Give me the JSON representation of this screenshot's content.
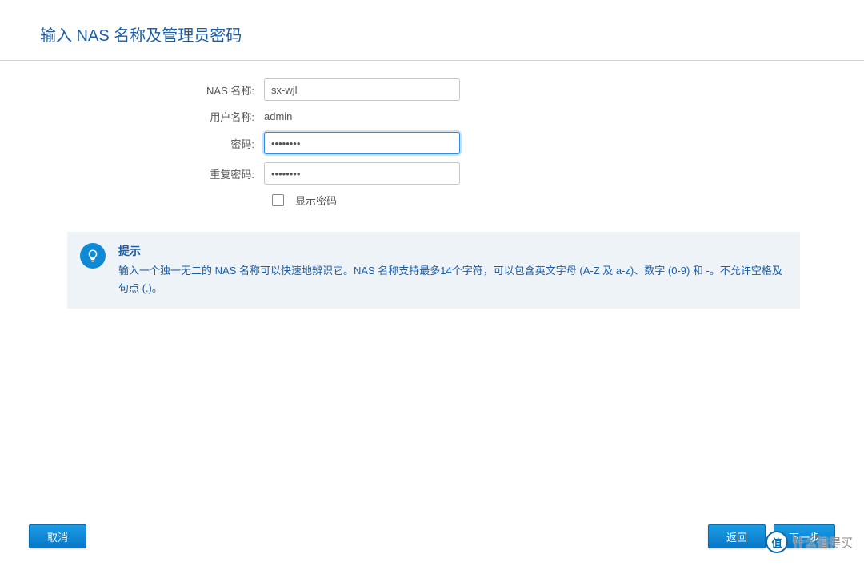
{
  "header": {
    "title": "输入 NAS 名称及管理员密码"
  },
  "form": {
    "nasNameLabel": "NAS 名称:",
    "nasNameValue": "sx-wjl",
    "usernameLabel": "用户名称:",
    "usernameValue": "admin",
    "passwordLabel": "密码:",
    "passwordValue": "••••••••",
    "repeatPasswordLabel": "重复密码:",
    "repeatPasswordValue": "••••••••",
    "showPasswordLabel": "显示密码"
  },
  "tip": {
    "title": "提示",
    "text": "输入一个独一无二的 NAS 名称可以快速地辨识它。NAS 名称支持最多14个字符，可以包含英文字母 (A-Z 及 a-z)、数字 (0-9) 和 -。不允许空格及句点 (.)。"
  },
  "buttons": {
    "cancel": "取消",
    "back": "返回",
    "next": "下一步"
  },
  "watermark": {
    "badge": "值",
    "text": "什么值得买"
  }
}
